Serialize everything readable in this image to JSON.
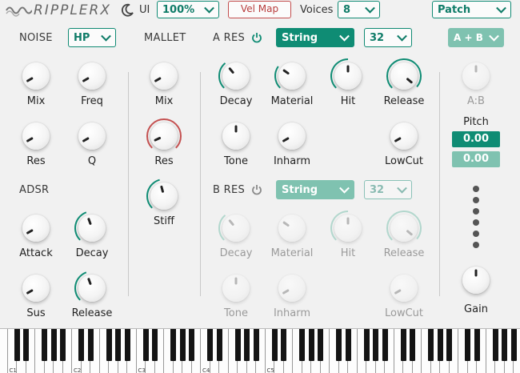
{
  "header": {
    "logo": "RIPPLERX",
    "ui_label": "UI",
    "ui_scale": "100%",
    "vel_map_label": "Vel Map",
    "voices_label": "Voices",
    "voices_value": "8",
    "patch_value": "Patch"
  },
  "noise": {
    "title": "NOISE",
    "filter_type": "HP",
    "knobs": [
      {
        "label": "Mix"
      },
      {
        "label": "Freq"
      },
      {
        "label": "Res"
      },
      {
        "label": "Q"
      }
    ]
  },
  "adsr": {
    "title": "ADSR",
    "knobs": [
      {
        "label": "Attack"
      },
      {
        "label": "Decay"
      },
      {
        "label": "Sus"
      },
      {
        "label": "Release"
      }
    ]
  },
  "mallet": {
    "title": "MALLET",
    "knobs": [
      {
        "label": "Mix"
      },
      {
        "label": "Res"
      },
      {
        "label": "Stiff"
      }
    ]
  },
  "a_res": {
    "title": "A RES",
    "model": "String",
    "partials": "32",
    "knobs": [
      {
        "label": "Decay"
      },
      {
        "label": "Material"
      },
      {
        "label": "Hit"
      },
      {
        "label": "Release"
      },
      {
        "label": "Tone"
      },
      {
        "label": "Inharm"
      },
      {
        "label": "LowCut"
      }
    ]
  },
  "b_res": {
    "title": "B RES",
    "model": "String",
    "partials": "32",
    "knobs": [
      {
        "label": "Decay"
      },
      {
        "label": "Material"
      },
      {
        "label": "Hit"
      },
      {
        "label": "Release"
      },
      {
        "label": "Tone"
      },
      {
        "label": "Inharm"
      },
      {
        "label": "LowCut"
      }
    ]
  },
  "right": {
    "couple_mode": "A + B",
    "ab_label": "A:B",
    "pitch_label": "Pitch",
    "pitch_a": "0.00",
    "pitch_b": "0.00",
    "gain_label": "Gain"
  },
  "keyboard": {
    "octave_labels": [
      "C1",
      "C2",
      "C3",
      "C4",
      "C5"
    ]
  },
  "colors": {
    "accent": "#0f8c74",
    "accent_light": "#7fc2b0",
    "mallet_ring": "#c45050",
    "background": "#f1f1f1"
  }
}
